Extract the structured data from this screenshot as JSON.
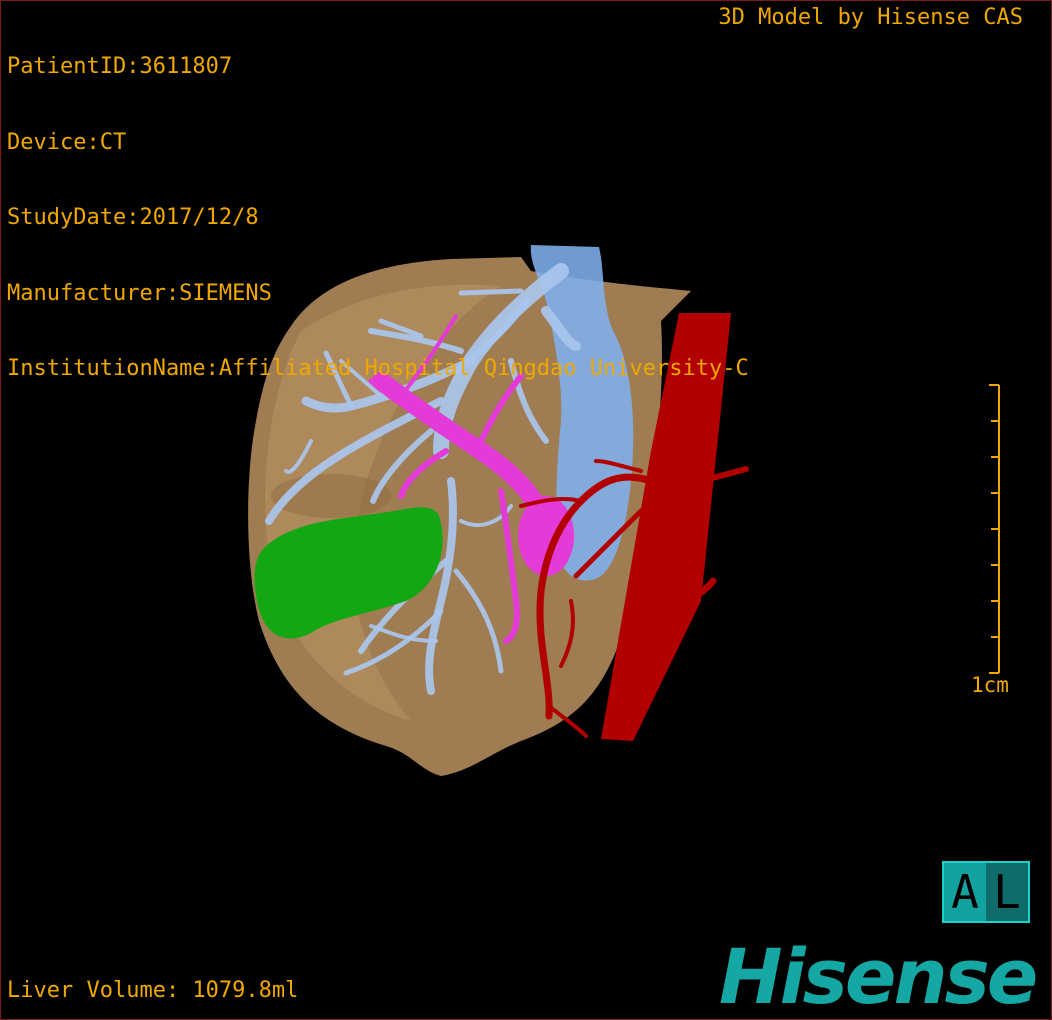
{
  "info": {
    "patient_id": "PatientID:3611807",
    "device": "Device:CT",
    "study_date": "StudyDate:2017/12/8",
    "manufacturer": "Manufacturer:SIEMENS",
    "institution": "InstitutionName:Affiliated Hospital Qingdao University-C"
  },
  "credit": "3D Model by Hisense CAS",
  "volume": "Liver Volume: 1079.8ml",
  "scale": {
    "label": "1cm"
  },
  "orientation": {
    "left": "A",
    "right": "L"
  },
  "logo": "Hisense",
  "colors": {
    "text": "#f0a800",
    "liver": "#b08a5a",
    "portal_vein": "#a9c6ee",
    "hepatic_vein_ivc": "#7fb0ee",
    "tumor_vessel": "#e43ad8",
    "artery": "#b20000",
    "gallbladder": "#13a813",
    "logo": "#14a7a4"
  }
}
